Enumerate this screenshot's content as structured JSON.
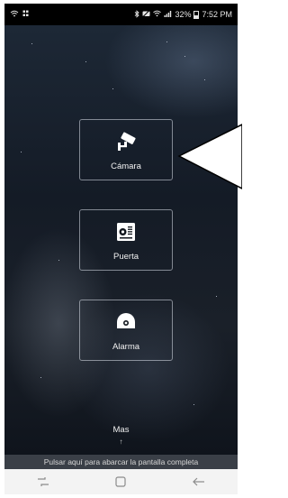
{
  "status_bar": {
    "signal_icons": [
      "wifi-icon",
      "notification-icon"
    ],
    "battery_percent": "32%",
    "time": "7:52 PM"
  },
  "tiles": [
    {
      "label": "Cámara",
      "icon": "cctv-camera-icon"
    },
    {
      "label": "Puerta",
      "icon": "door-intercom-icon"
    },
    {
      "label": "Alarma",
      "icon": "alarm-icon"
    }
  ],
  "more": {
    "label": "Mas",
    "arrow": "↑"
  },
  "banner": {
    "text": "Pulsar aquí para abarcar la pantalla completa"
  },
  "nav": {
    "recent": "recent-apps-icon",
    "home": "home-icon",
    "back": "back-icon"
  },
  "colors": {
    "accent_white": "#ffffff",
    "banner_bg": "#3a3f47",
    "nav_bg": "#f3f3f3"
  }
}
